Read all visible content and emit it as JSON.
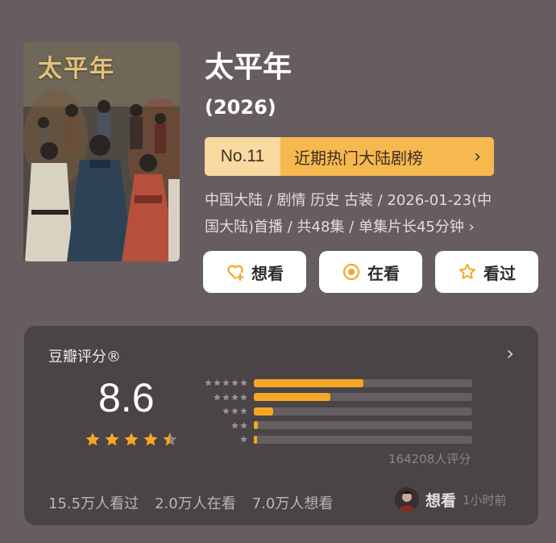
{
  "show": {
    "poster_title": "太平年",
    "title": "太平年",
    "year": "(2026)",
    "rank_no": "No.11",
    "rank_name": "近期热门大陆剧榜",
    "meta_line1": "中国大陆 / 剧情 历史 古装 / 2026-01-23(中",
    "meta_line2": "国大陆)首播 / 共48集 / 单集片长45分钟 ›"
  },
  "actions": {
    "want": "想看",
    "watching": "在看",
    "watched": "看过"
  },
  "rating": {
    "title": "豆瓣评分®",
    "score": "8.6",
    "stars": 4.5,
    "distribution_percent": [
      50,
      35,
      9,
      2,
      1.5
    ],
    "rating_count": "164208人评分",
    "watched": "15.5万人看过",
    "watching": "2.0万人在看",
    "want": "7.0万人想看",
    "recent_action": "想看",
    "recent_time": "1小时前"
  },
  "colors": {
    "background": "#665d60",
    "card": "#4b4446",
    "accent": "#f5a623",
    "rank_light": "#f8d9a0"
  }
}
